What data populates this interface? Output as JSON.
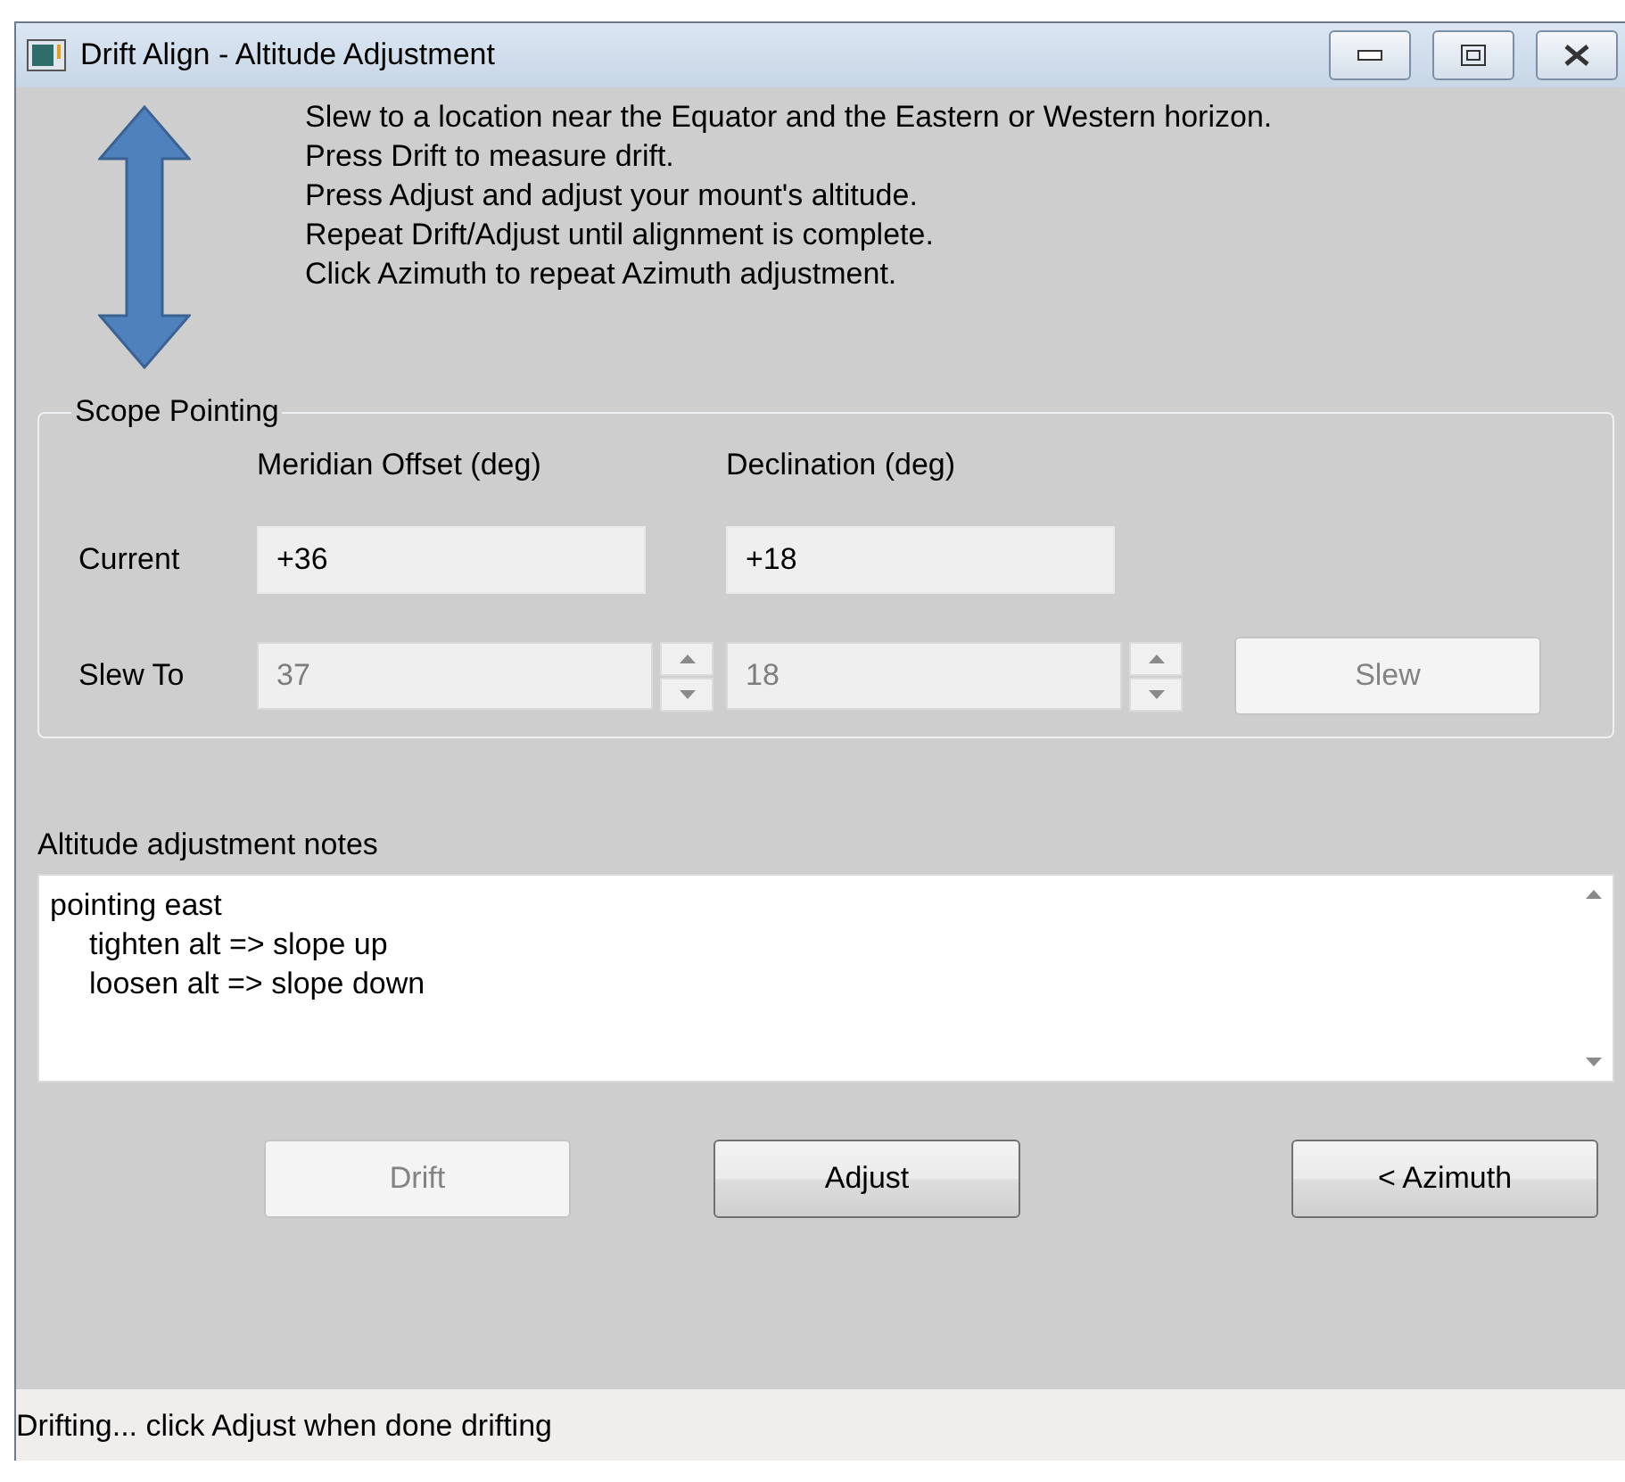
{
  "window": {
    "title": "Drift Align - Altitude Adjustment"
  },
  "instructions": [
    "Slew to a location near the Equator and the Eastern or Western horizon.",
    "Press Drift to measure drift.",
    "Press Adjust and adjust your mount's altitude.",
    "Repeat Drift/Adjust until alignment is complete.",
    "Click Azimuth to repeat Azimuth adjustment."
  ],
  "scope_pointing": {
    "title": "Scope Pointing",
    "columns": [
      "Meridian Offset (deg)",
      "Declination (deg)"
    ],
    "rows": [
      {
        "kind": "readout",
        "label": "Current",
        "values": [
          "+36",
          "+18"
        ],
        "disabled": false
      },
      {
        "kind": "spinner",
        "label": "Slew To",
        "values": [
          "37",
          "18"
        ],
        "disabled": true,
        "button": {
          "label": "Slew",
          "disabled": true
        }
      }
    ]
  },
  "notes": {
    "label": "Altitude adjustment notes",
    "lines": [
      {
        "text": "pointing east",
        "children": [
          {
            "text": "tighten alt => slope up"
          },
          {
            "text": "loosen alt => slope down"
          }
        ]
      }
    ]
  },
  "buttons": [
    {
      "label": "Drift",
      "disabled": true
    },
    {
      "label": "Adjust",
      "disabled": false
    },
    {
      "label": "< Azimuth",
      "disabled": false
    }
  ],
  "status_bar": "Drifting... click Adjust when done drifting"
}
